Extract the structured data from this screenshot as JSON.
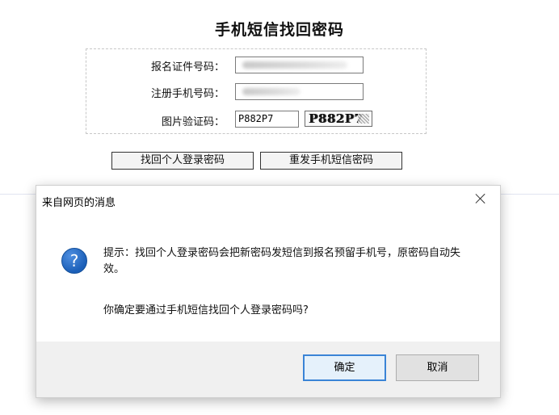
{
  "page": {
    "title": "手机短信找回密码"
  },
  "form": {
    "id_label": "报名证件号码：",
    "id_value": "",
    "phone_label": "注册手机号码：",
    "phone_value": "",
    "captcha_label": "图片验证码：",
    "captcha_input": "P882P7",
    "captcha_image_text": "P882P7"
  },
  "buttons": {
    "recover": "找回个人登录密码",
    "resend": "重发手机短信密码"
  },
  "dialog": {
    "title": "来自网页的消息",
    "icon": "question-icon",
    "message": "提示：找回个人登录密码会把新密码发短信到报名预留手机号，原密码自动失效。",
    "confirm": "你确定要通过手机短信找回个人登录密码吗?",
    "ok_label": "确定",
    "cancel_label": "取消"
  },
  "colors": {
    "dialog_footer": "#f0f0f0",
    "ok_border": "#3a84d6",
    "question_icon": "#1b5fb8"
  }
}
